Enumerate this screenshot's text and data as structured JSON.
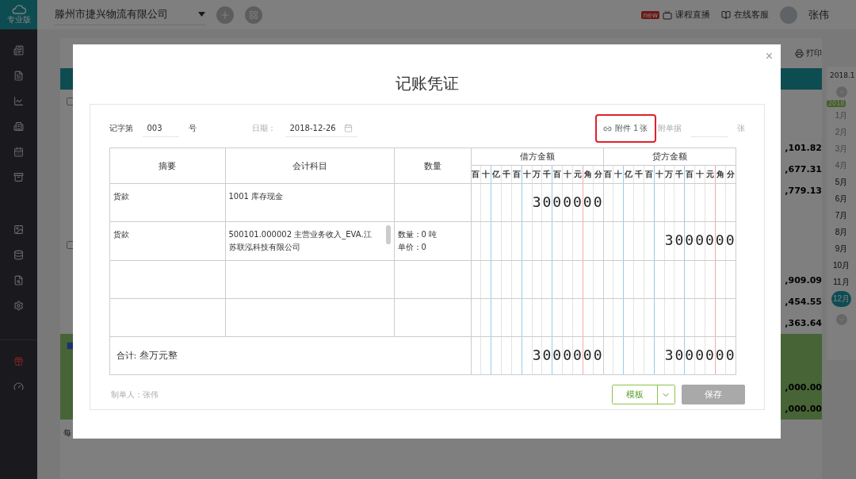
{
  "app": {
    "logo_label": "专业版",
    "company": "滕州市捷兴物流有限公司",
    "header_links": [
      {
        "label": "课程直播",
        "badge": "new"
      },
      {
        "label": "在线客服"
      }
    ],
    "user": "张伟"
  },
  "background": {
    "print_label": "打印",
    "period": "2018.1",
    "year_badge": "2018",
    "groups": [
      {
        "checked": false,
        "amounts": [
          ",101.82",
          ",677.31",
          ",779.13"
        ]
      },
      {
        "checked": false,
        "amounts": [
          ",909.09",
          ",454.55",
          ",363.64"
        ]
      },
      {
        "checked": true,
        "amounts": [
          ",000.00",
          ",000.00"
        ]
      }
    ],
    "footer_text": "每",
    "months": [
      {
        "label": "1月",
        "disabled": true,
        "selected": false
      },
      {
        "label": "2月",
        "disabled": true,
        "selected": false
      },
      {
        "label": "3月",
        "disabled": true,
        "selected": false
      },
      {
        "label": "4月",
        "disabled": true,
        "selected": false
      },
      {
        "label": "5月",
        "disabled": false,
        "selected": false
      },
      {
        "label": "6月",
        "disabled": false,
        "selected": false
      },
      {
        "label": "7月",
        "disabled": false,
        "selected": false
      },
      {
        "label": "8月",
        "disabled": false,
        "selected": false
      },
      {
        "label": "9月",
        "disabled": false,
        "selected": false
      },
      {
        "label": "10月",
        "disabled": false,
        "selected": false
      },
      {
        "label": "11月",
        "disabled": false,
        "selected": false
      },
      {
        "label": "12月",
        "disabled": false,
        "selected": true
      }
    ]
  },
  "dialog": {
    "title": "记账凭证",
    "close": "×",
    "voucher_prefix": "记字第",
    "voucher_no": "003",
    "voucher_suffix": "号",
    "date_label": "日期：",
    "date": "2018-12-26",
    "attachment": {
      "label": "附件 1 张",
      "highlighted": true
    },
    "doc_label": "附单据",
    "doc_unit": "张",
    "columns": [
      "摘要",
      "会计科目",
      "数量",
      "借方金额",
      "贷方金额"
    ],
    "debit_units": [
      "百",
      "十",
      "亿",
      "千",
      "百",
      "十",
      "万",
      "千",
      "百",
      "十",
      "元",
      "角",
      "分"
    ],
    "credit_units": [
      "百",
      "十",
      "亿",
      "千",
      "百",
      "十",
      "万",
      "千",
      "百",
      "十",
      "元",
      "角",
      "分"
    ],
    "rows": [
      {
        "summary": "货款",
        "account": "1001 库存现金",
        "quantity": [],
        "debit": "3000000",
        "credit": "",
        "scrollbar": false
      },
      {
        "summary": "货款",
        "account": "500101.000002 主营业务收入_EVA.江苏联泓科技有限公司",
        "quantity": [
          "数量：0 吨",
          "单价：0"
        ],
        "debit": "",
        "credit": "3000000",
        "scrollbar": true
      },
      {
        "summary": "",
        "account": "",
        "quantity": [],
        "debit": "",
        "credit": "",
        "scrollbar": false
      },
      {
        "summary": "",
        "account": "",
        "quantity": [],
        "debit": "",
        "credit": "",
        "scrollbar": false
      }
    ],
    "total": {
      "label": "合计:",
      "words": "叁万元整",
      "debit": "3000000",
      "credit": "3000000"
    },
    "maker": "制单人：张伟",
    "template_button": "模板",
    "save_button": {
      "label": "保存",
      "disabled": true
    }
  }
}
